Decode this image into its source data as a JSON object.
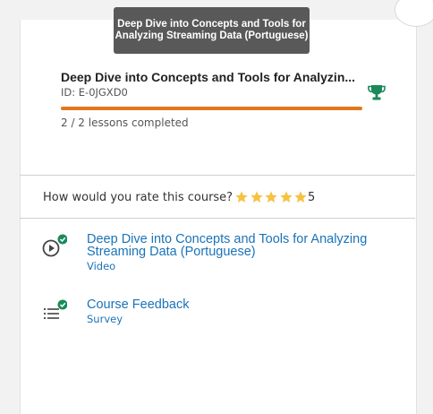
{
  "tooltip": {
    "text": "Deep Dive into Concepts and Tools for Analyzing Streaming Data (Portuguese)"
  },
  "course": {
    "title": "Deep Dive into Concepts and Tools for Analyzin...",
    "id": "ID: E-0JGXD0",
    "progress_fraction": 1.0,
    "lessons_completed": "2 / 2 lessons completed",
    "trophy_color": "#1a8a5a",
    "progress_color": "#e0781c"
  },
  "rating": {
    "question": "How would you rate this course?",
    "stars_filled": 5,
    "stars_total": 5,
    "value": "5",
    "star_color": "#f5c242"
  },
  "items": [
    {
      "title": "Deep Dive into Concepts and Tools for Analyzing Streaming Data (Portuguese)",
      "type": "Video",
      "icon": "play-circle-icon",
      "completed": true
    },
    {
      "title": "Course Feedback",
      "type": "Survey",
      "icon": "list-icon",
      "completed": true
    }
  ],
  "colors": {
    "link": "#1a73b8",
    "check": "#1a8a5a"
  }
}
